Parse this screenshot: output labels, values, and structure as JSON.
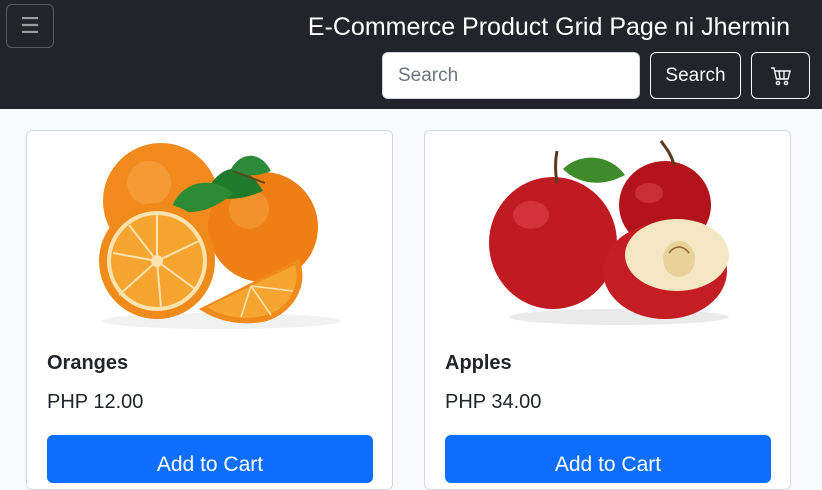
{
  "navbar": {
    "toggler_icon": "menu-icon",
    "brand": "E-Commerce Product Grid Page ni Jhermin",
    "search": {
      "placeholder": "Search",
      "value": ""
    },
    "search_button": "Search",
    "cart_icon": "cart-icon"
  },
  "products": [
    {
      "name": "Oranges",
      "price": "PHP 12.00",
      "button": "Add to Cart",
      "image": "oranges-photo"
    },
    {
      "name": "Apples",
      "price": "PHP 34.00",
      "button": "Add to Cart",
      "image": "apples-photo"
    }
  ],
  "colors": {
    "navbar_bg": "#212529",
    "primary": "#0d6efd",
    "page_bg": "#f8f9fa"
  }
}
